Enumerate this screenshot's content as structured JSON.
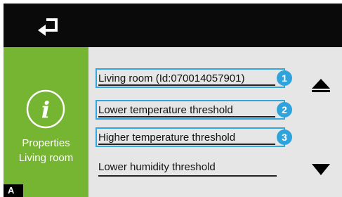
{
  "sidebar": {
    "title_line1": "Properties",
    "title_line2": "Living room",
    "info_glyph": "i",
    "icon": "info-icon"
  },
  "corner_label": "A",
  "list": {
    "items": [
      {
        "label": "Living room (Id:070014057901)",
        "badge": "1",
        "highlighted": true
      },
      {
        "label": "Lower temperature threshold",
        "badge": "2",
        "highlighted": true
      },
      {
        "label": "Higher temperature threshold",
        "badge": "3",
        "highlighted": true
      },
      {
        "label": "Lower humidity threshold",
        "badge": "",
        "highlighted": false
      }
    ]
  },
  "icons": {
    "back": "return-arrow-icon",
    "scroll_up": "triangle-up-icon",
    "scroll_down": "triangle-down-icon"
  },
  "colors": {
    "topbar": "#0a0a0a",
    "sidebar": "#76b532",
    "content": "#e6e6e6",
    "highlight": "#33a6dc"
  }
}
